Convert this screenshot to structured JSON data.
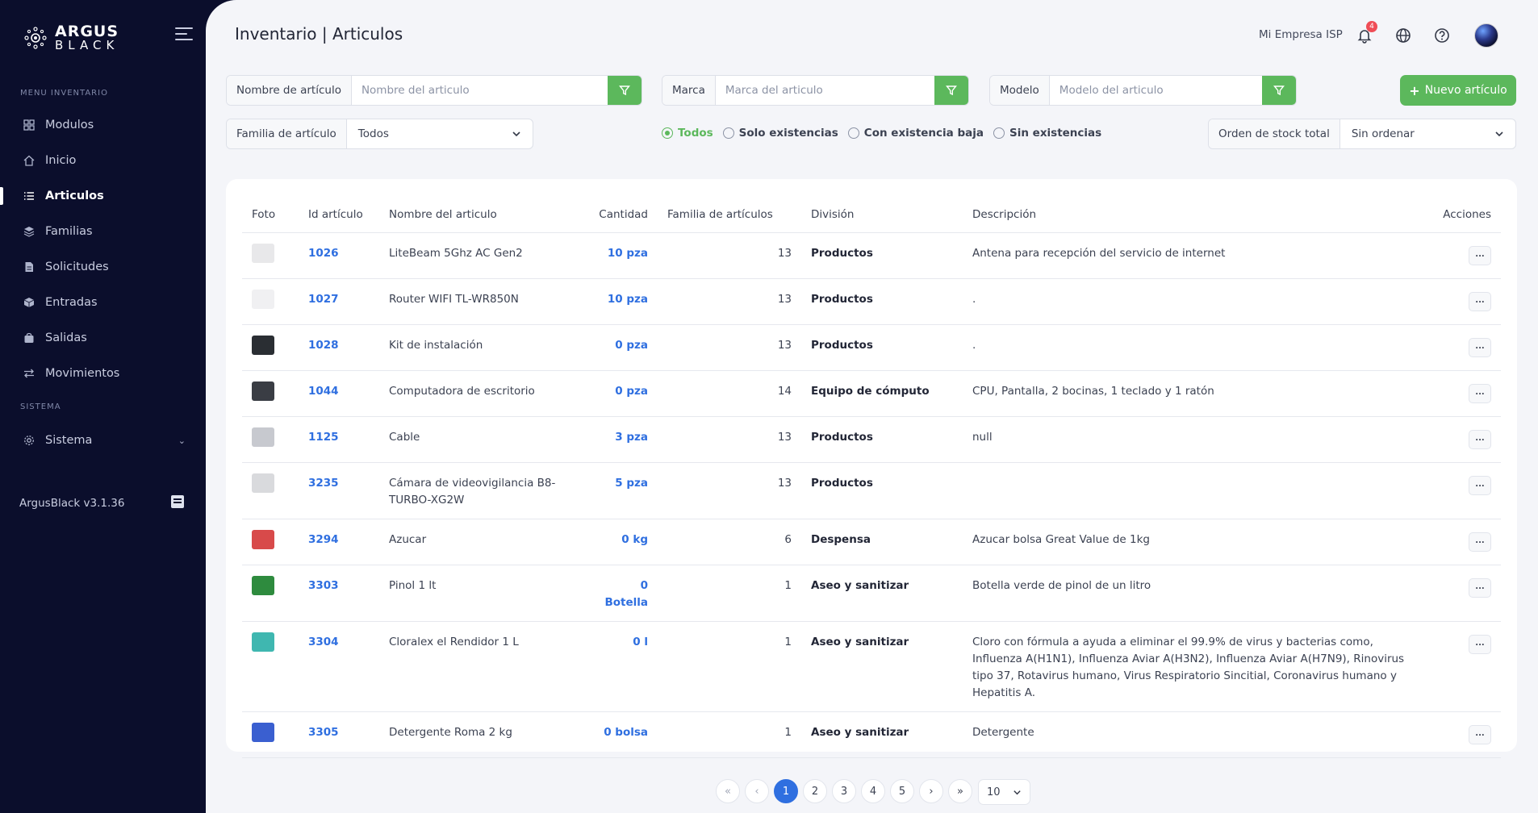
{
  "sidebar": {
    "logo_line1": "ARGUS",
    "logo_line2": "BLACK",
    "section_inventory": "MENU INVENTARIO",
    "section_system": "SISTEMA",
    "items": [
      {
        "label": "Modulos",
        "icon": "grid-icon"
      },
      {
        "label": "Inicio",
        "icon": "home-icon"
      },
      {
        "label": "Articulos",
        "icon": "list-icon",
        "active": true
      },
      {
        "label": "Familias",
        "icon": "layers-icon"
      },
      {
        "label": "Solicitudes",
        "icon": "document-icon"
      },
      {
        "label": "Entradas",
        "icon": "box-icon"
      },
      {
        "label": "Salidas",
        "icon": "bag-icon"
      },
      {
        "label": "Movimientos",
        "icon": "arrows-icon"
      }
    ],
    "system_item": "Sistema",
    "version": "ArgusBlack v3.1.36"
  },
  "header": {
    "title": "Inventario | Articulos",
    "company": "Mi Empresa ISP",
    "notification_count": "4"
  },
  "filters": {
    "name_label": "Nombre de artículo",
    "name_placeholder": "Nombre del articulo",
    "brand_label": "Marca",
    "brand_placeholder": "Marca del articulo",
    "model_label": "Modelo",
    "model_placeholder": "Modelo del articulo",
    "new_button": "Nuevo artículo",
    "family_label": "Familia de artículo",
    "family_value": "Todos",
    "stock_order_label": "Orden de stock total",
    "stock_order_value": "Sin ordenar",
    "radios": [
      "Todos",
      "Solo existencias",
      "Con existencia baja",
      "Sin existencias"
    ],
    "radio_selected": "Todos"
  },
  "table": {
    "columns": [
      "Foto",
      "Id artículo",
      "Nombre del articulo",
      "Cantidad",
      "Familia de artículos",
      "División",
      "Descripción",
      "Acciones"
    ],
    "action_label": "...",
    "rows": [
      {
        "id": "1026",
        "name": "LiteBeam 5Ghz AC Gen2",
        "qty": "10 pza",
        "family": "13",
        "division": "Productos",
        "desc": "Antena para recepción del servicio de internet",
        "thumb": "#e8e8ea"
      },
      {
        "id": "1027",
        "name": "Router WIFI TL-WR850N",
        "qty": "10 pza",
        "family": "13",
        "division": "Productos",
        "desc": ".",
        "thumb": "#f0f0f2"
      },
      {
        "id": "1028",
        "name": "Kit de instalación",
        "qty": "0 pza",
        "family": "13",
        "division": "Productos",
        "desc": ".",
        "thumb": "#2a2e33"
      },
      {
        "id": "1044",
        "name": "Computadora de escritorio",
        "qty": "0 pza",
        "family": "14",
        "division": "Equipo de cómputo",
        "desc": "CPU, Pantalla, 2 bocinas, 1 teclado y 1 ratón",
        "thumb": "#3a3d44"
      },
      {
        "id": "1125",
        "name": "Cable",
        "qty": "3 pza",
        "family": "13",
        "division": "Productos",
        "desc": "null",
        "thumb": "#c7c9cf"
      },
      {
        "id": "3235",
        "name": "Cámara de videovigilancia B8-TURBO-XG2W",
        "qty": "5 pza",
        "family": "13",
        "division": "Productos",
        "desc": "",
        "thumb": "#d9dadd"
      },
      {
        "id": "3294",
        "name": "Azucar",
        "qty": "0 kg",
        "family": "6",
        "division": "Despensa",
        "desc": "Azucar bolsa Great Value de 1kg",
        "thumb": "#d84a4a"
      },
      {
        "id": "3303",
        "name": "Pinol 1 lt",
        "qty": "0 Botella",
        "family": "1",
        "division": "Aseo y sanitizar",
        "desc": "Botella verde de pinol de un litro",
        "thumb": "#2e8b3e"
      },
      {
        "id": "3304",
        "name": "Cloralex el Rendidor 1 L",
        "qty": "0 l",
        "family": "1",
        "division": "Aseo y sanitizar",
        "desc": "Cloro con fórmula a ayuda a eliminar el 99.9% de virus y bacterias como, Influenza A(H1N1), Influenza Aviar A(H3N2), Influenza Aviar A(H7N9), Rinovirus tipo 37, Rotavirus humano, Virus Respiratorio Sincitial, Coronavirus humano y Hepatitis A.",
        "thumb": "#3fb7b0"
      },
      {
        "id": "3305",
        "name": "Detergente Roma 2 kg",
        "qty": "0 bolsa",
        "family": "1",
        "division": "Aseo y sanitizar",
        "desc": "Detergente",
        "thumb": "#3a5fd0"
      }
    ]
  },
  "pagination": {
    "first": "«",
    "prev": "‹",
    "pages": [
      "1",
      "2",
      "3",
      "4",
      "5"
    ],
    "current": "1",
    "next": "›",
    "last": "»",
    "per_page": "10"
  }
}
